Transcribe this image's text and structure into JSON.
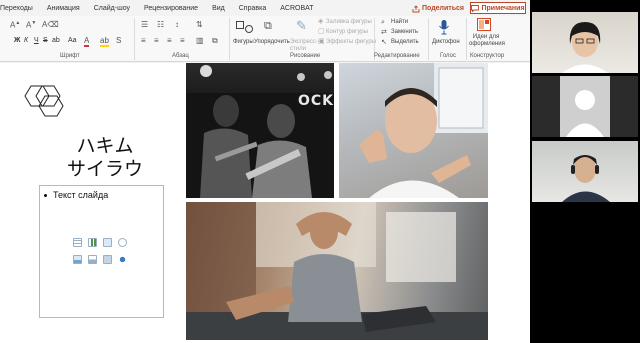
{
  "ribbon_tabs": [
    "Переходы",
    "Анимация",
    "Слайд-шоу",
    "Рецензирование",
    "Вид",
    "Справка",
    "ACROBAT"
  ],
  "share_label": "Поделиться",
  "comments_label": "Примечания",
  "font_group": {
    "label": "Шрифт",
    "bold": "Ж",
    "italic": "К",
    "underline": "Ч",
    "strike": "S",
    "spacing": "ab",
    "case": "Aa"
  },
  "paragraph_group": {
    "label": "Абзац"
  },
  "drawing_group": {
    "label": "Рисование",
    "shapes": "Фигуры",
    "arrange": "Упорядочить",
    "quick_styles": "Экспресс-стили",
    "fill": "Заливка фигуры",
    "outline": "Контур фигуры",
    "effects": "Эффекты фигуры"
  },
  "editing_group": {
    "label": "Редактирование",
    "find": "Найти",
    "replace": "Заменить",
    "select": "Выделить"
  },
  "voice_group": {
    "label": "Голос",
    "dictate": "Диктофон"
  },
  "designer_group": {
    "label": "Конструктор",
    "design_ideas": "Идеи для оформления"
  },
  "slide": {
    "title_line1": "ハキム",
    "title_line2": "サイラウ",
    "bullet_text": "Текст слайда",
    "band_sign": "OCK"
  },
  "accent_color": "#b7472a",
  "icons": [
    "comment-icon",
    "share-icon",
    "search-icon",
    "replace-icon",
    "select-icon",
    "microphone-icon",
    "designer-icon",
    "hexagon-icon",
    "person-silhouette-icon"
  ]
}
